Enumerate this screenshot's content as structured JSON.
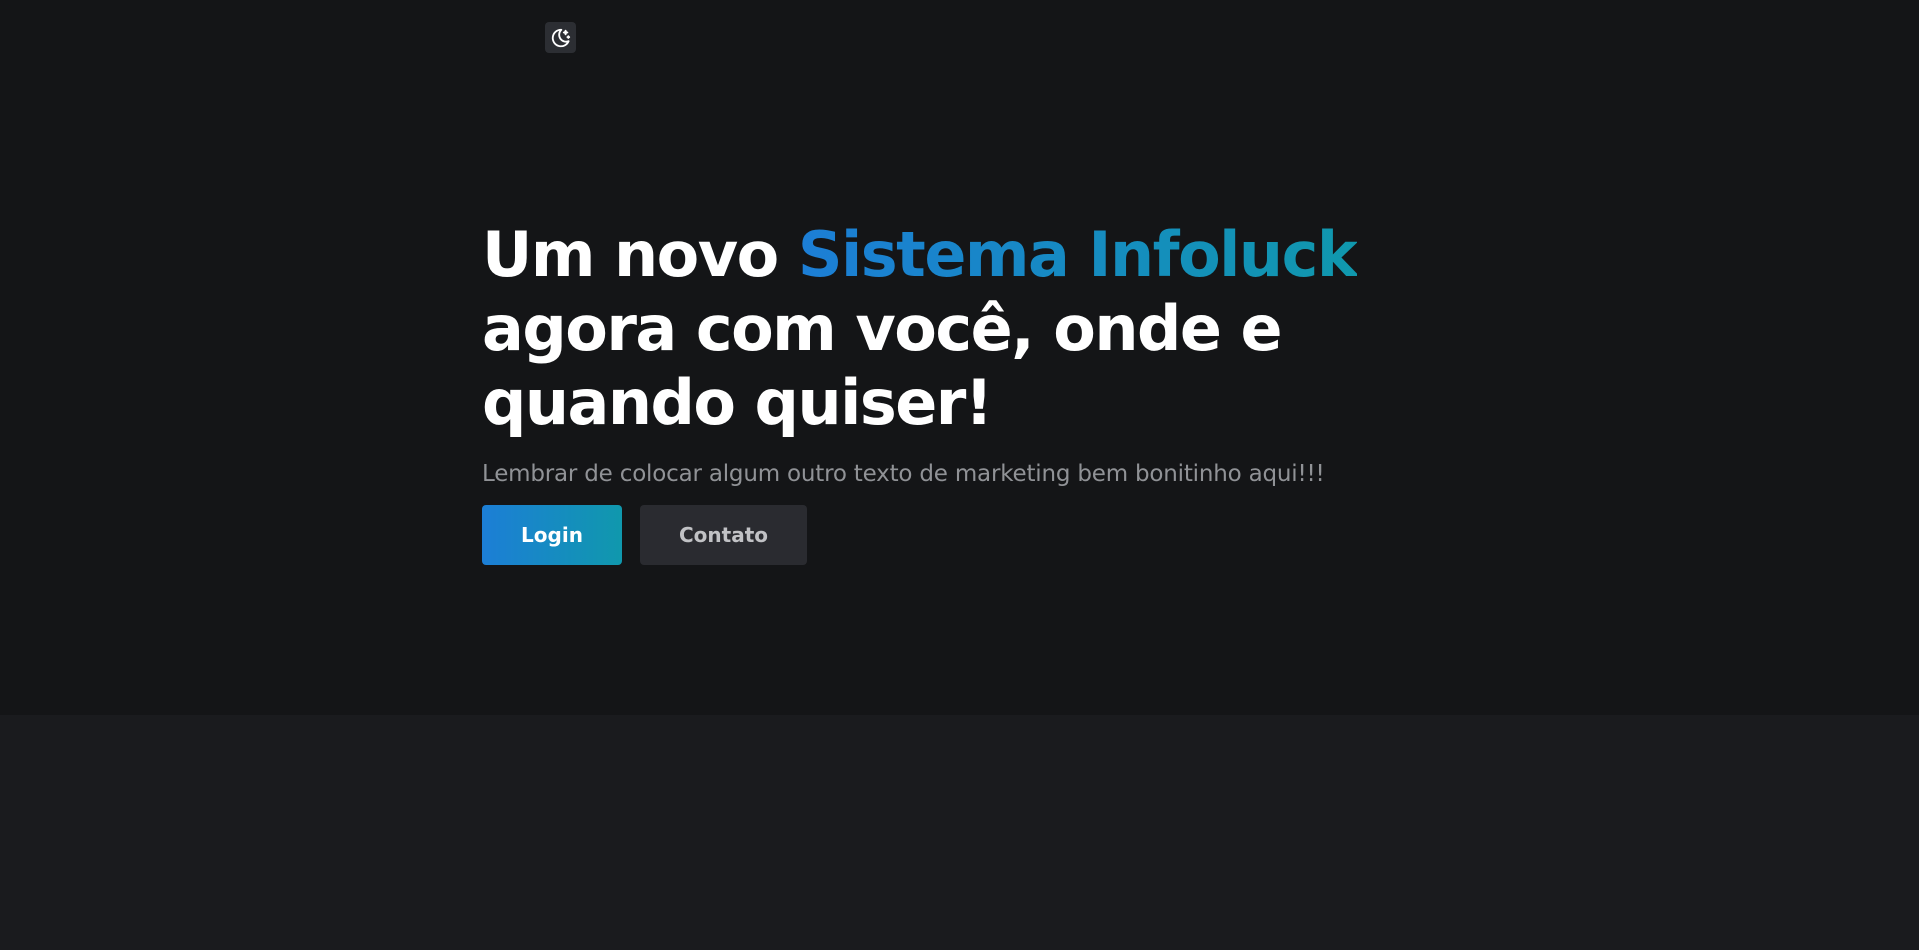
{
  "theme_toggle": {
    "icon": "moon-stars-icon"
  },
  "hero": {
    "headline_start": "Um novo ",
    "headline_accent": "Sistema Infoluck",
    "headline_end": " agora com você, onde e quando quiser!",
    "subtitle": "Lembrar de colocar algum outro texto de marketing bem bonitinho aqui!!!",
    "login_label": "Login",
    "contact_label": "Contato"
  },
  "colors": {
    "hero_background": "#141517",
    "page_background": "#1a1b1e",
    "accent_gradient_start": "#1c7ed6",
    "accent_gradient_end": "#1098ad",
    "secondary_button": "#2a2b30",
    "subtitle_text": "#909296"
  }
}
